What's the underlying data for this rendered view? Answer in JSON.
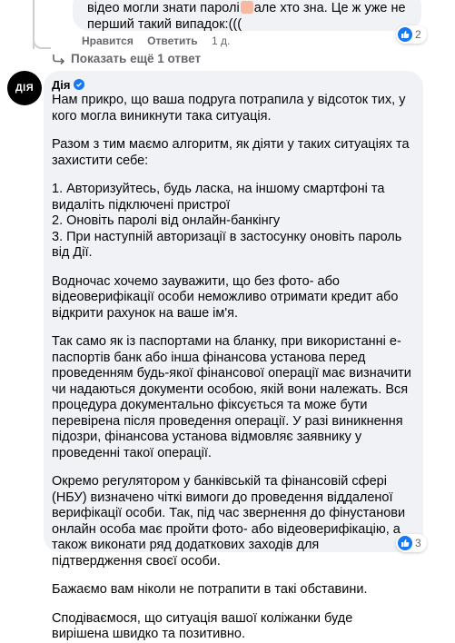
{
  "previous_comment": {
    "text_before_emoji": "відео могли знати паролі",
    "text_after_emoji": "але хто зна. Це ж уже не перший такий випадок:(((",
    "like_label": "Нравится",
    "reply_label": "Ответить",
    "time": "1 д.",
    "reaction_count": "2"
  },
  "show_more": {
    "label": "Показать ещё 1 ответ"
  },
  "reply": {
    "avatar_text": "ДІЯ",
    "author": "Дія",
    "paragraphs": [
      "Нам прикро, що ваша подруга потрапила у відсоток тих, у кого могла виникнути така ситуація.",
      "Разом з тим маємо алгоритм, як діяти у таких ситуаціях та захистити себе:",
      "1. Авторизуйтесь, будь ласка, на іншому смартфоні та видаліть підключені пристрої\n2. Оновіть паролі від онлайн-банкінгу\n3. При наступній авторизації в застосунку оновіть пароль від Дії.",
      "Водночас хочемо зауважити, що без фото- або відеоверифікації особи неможливо отримати кредит або відкрити рахунок на ваше ім'я.",
      "Так само як із паспортами на бланку, при використанні е-паспортів банк або інша фінансова установа перед проведенням будь-якої фінансової операції має визначити чи надаються документи особою, якій вони належать. Вся процедура документально фіксується та може бути перевірена після проведення операції. У разі виникнення підозри, фінансова установа відмовляє заявнику у проведенні такої операції.",
      "Окремо регулятором у банківській та фінансовій сфері (НБУ) визначено чіткі вимоги до проведення віддаленої верифікації особи. Так, під час звернення до фінустанови онлайн особа має пройти фото- або відеоверифікацію, а також виконати ряд додаткових заходів для підтвердження своєї особи.",
      "Бажаємо вам ніколи не потрапити в такі обставини.",
      "Сподіваємося, що ситуація вашої коліжанки буде вирішена швидко та позитивно."
    ],
    "reaction_count": "3"
  }
}
